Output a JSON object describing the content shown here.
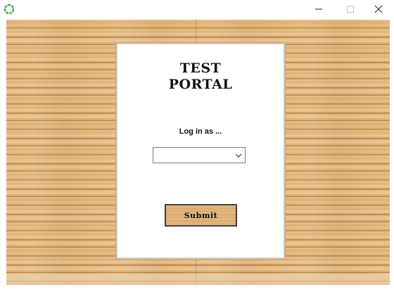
{
  "window": {
    "icons": {
      "app": "app-ring-icon",
      "minimize": "minimize-icon",
      "maximize": "maximize-icon",
      "close": "close-icon"
    }
  },
  "login": {
    "title_line1": "TEST",
    "title_line2": "PORTAL",
    "prompt": "Log in as ...",
    "role_select": {
      "value": ""
    },
    "submit_label": "Submit"
  },
  "colors": {
    "wood": "#e2b67a",
    "panel": "#ffffff",
    "app_icon": "#3aa84a"
  }
}
